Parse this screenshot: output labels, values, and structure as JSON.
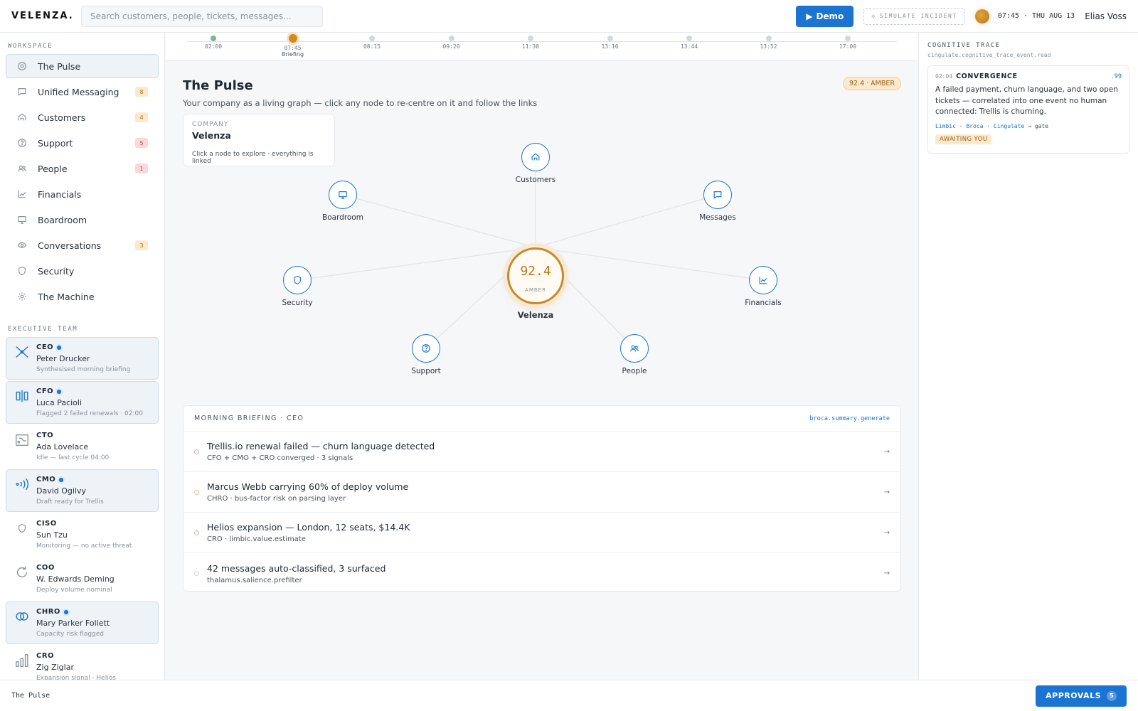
{
  "app": {
    "logo": "VELENZA.",
    "search_placeholder": "Search customers, people, tickets, messages...",
    "demo_label": "Demo",
    "simulate_label": "SIMULATE INCIDENT",
    "clock": "07:45 · THU AUG 13",
    "user": "Elias Voss"
  },
  "sidebar": {
    "workspace_label": "WORKSPACE",
    "items": [
      {
        "label": "The Pulse",
        "icon": "pulse-icon"
      },
      {
        "label": "Unified Messaging",
        "icon": "chat-icon",
        "badge": "8",
        "badge_tone": "amber"
      },
      {
        "label": "Customers",
        "icon": "home-icon",
        "badge": "4",
        "badge_tone": "amber"
      },
      {
        "label": "Support",
        "icon": "help-icon",
        "badge": "5",
        "badge_tone": "red"
      },
      {
        "label": "People",
        "icon": "people-icon",
        "badge": "1",
        "badge_tone": "red"
      },
      {
        "label": "Financials",
        "icon": "chart-icon"
      },
      {
        "label": "Boardroom",
        "icon": "monitor-icon"
      },
      {
        "label": "Conversations",
        "icon": "eye-icon",
        "badge": "3",
        "badge_tone": "amber"
      },
      {
        "label": "Security",
        "icon": "shield-icon"
      },
      {
        "label": "The Machine",
        "icon": "gear-icon"
      }
    ],
    "exec_label": "EXECUTIVE TEAM",
    "execs": [
      {
        "role": "CEO",
        "name": "Peter Drucker",
        "status": "Synthesised morning briefing",
        "live": true,
        "icon": "cross-icon"
      },
      {
        "role": "CFO",
        "name": "Luca Pacioli",
        "status": "Flagged 2 failed renewals · 02:00",
        "live": true,
        "icon": "columns-icon"
      },
      {
        "role": "CTO",
        "name": "Ada Lovelace",
        "status": "Idle — last cycle 04:00",
        "live": false,
        "icon": "circuit-icon"
      },
      {
        "role": "CMO",
        "name": "David Ogilvy",
        "status": "Draft ready for Trellis",
        "live": true,
        "icon": "broadcast-icon"
      },
      {
        "role": "CISO",
        "name": "Sun Tzu",
        "status": "Monitoring — no active threat",
        "live": false,
        "icon": "shield-icon"
      },
      {
        "role": "COO",
        "name": "W. Edwards Deming",
        "status": "Deploy volume nominal",
        "live": false,
        "icon": "cycle-icon"
      },
      {
        "role": "CHRO",
        "name": "Mary Parker Follett",
        "status": "Capacity risk flagged",
        "live": true,
        "icon": "rings-icon"
      },
      {
        "role": "CRO",
        "name": "Zig Ziglar",
        "status": "Expansion signal · Helios",
        "live": false,
        "icon": "bars-icon"
      }
    ]
  },
  "timeline": [
    {
      "time": "02:00",
      "state": "done",
      "label": ""
    },
    {
      "time": "07:45",
      "state": "current",
      "label": "Briefing"
    },
    {
      "time": "08:15",
      "state": "future",
      "label": ""
    },
    {
      "time": "09:20",
      "state": "future",
      "label": ""
    },
    {
      "time": "11:30",
      "state": "future",
      "label": ""
    },
    {
      "time": "13:10",
      "state": "future",
      "label": ""
    },
    {
      "time": "13:44",
      "state": "future",
      "label": ""
    },
    {
      "time": "13:52",
      "state": "future",
      "label": ""
    },
    {
      "time": "17:00",
      "state": "future",
      "label": ""
    }
  ],
  "pulse": {
    "title": "The Pulse",
    "subtitle": "Your company as a living graph — click any node to re-centre on it and follow the links",
    "score_pill": "92.4 · AMBER",
    "company_card": {
      "kicker": "COMPANY",
      "name": "Velenza",
      "hint": "Click a node to explore · everything is linked"
    },
    "center": {
      "score": "92.4",
      "status": "AMBER",
      "label": "Velenza"
    },
    "nodes": [
      {
        "label": "Customers",
        "icon": "home-icon"
      },
      {
        "label": "Messages",
        "icon": "chat-icon"
      },
      {
        "label": "Financials",
        "icon": "chart-icon"
      },
      {
        "label": "People",
        "icon": "people-icon"
      },
      {
        "label": "Support",
        "icon": "help-icon"
      },
      {
        "label": "Security",
        "icon": "shield-icon"
      },
      {
        "label": "Boardroom",
        "icon": "monitor-icon"
      }
    ]
  },
  "briefing": {
    "title": "MORNING BRIEFING · CEO",
    "method": "broca.summary.generate",
    "items": [
      {
        "title": "Trellis.io renewal failed — churn language detected",
        "sub": "CFO + CMO + CRO converged · 3 signals",
        "tone": "#e7a3a3"
      },
      {
        "title": "Marcus Webb carrying 60% of deploy volume",
        "sub": "CHRO · bus-factor risk on parsing layer",
        "tone": "#efc98f"
      },
      {
        "title": "Helios expansion — London, 12 seats, $14.4K",
        "sub": "CRO · limbic.value.estimate",
        "tone": "#a9d3b3"
      },
      {
        "title": "42 messages auto-classified, 3 surfaced",
        "sub": "thalamus.salience.prefilter",
        "tone": "#d3d8de"
      }
    ]
  },
  "trace": {
    "title": "COGNITIVE TRACE",
    "method": "cingulate.cognitive_trace_event.read",
    "event": {
      "time": "02:04",
      "kind": "CONVERGENCE",
      "score": ".99",
      "body": "A failed payment, churn language, and two open tickets — correlated into one event no human connected: Trellis is churning.",
      "chain": [
        "Limbic",
        "Broca",
        "Cingulate"
      ],
      "chain_end": "gate",
      "tag": "AWAITING YOU"
    }
  },
  "footer": {
    "crumb": "The Pulse",
    "approvals_label": "APPROVALS",
    "approvals_count": "5"
  },
  "colors": {
    "accent": "#1b74d1",
    "amber": "#c8892a"
  }
}
